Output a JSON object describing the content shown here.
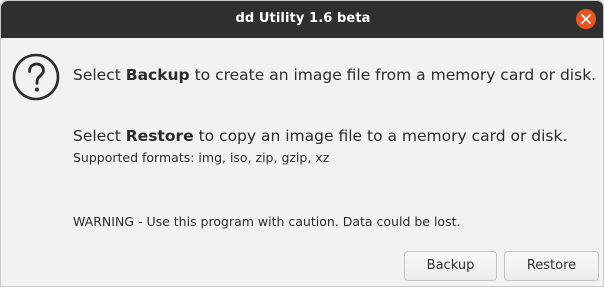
{
  "window": {
    "title": "dd Utility 1.6 beta",
    "accent_close_color": "#e95420",
    "titlebar_color": "#2f2f2f"
  },
  "icons": {
    "dialog": "question-mark-circle-icon",
    "close": "close-icon"
  },
  "message": {
    "line1_prefix": "Select ",
    "line1_bold": "Backup",
    "line1_suffix": " to create an image file from a memory card or disk.",
    "line2_prefix": "Select ",
    "line2_bold": "Restore",
    "line2_suffix": " to copy an image file to a memory card or disk.",
    "formats": "Supported formats: img, iso, zip, gzip, xz",
    "warning": "WARNING - Use this program with caution. Data could be lost."
  },
  "buttons": {
    "backup": "Backup",
    "restore": "Restore"
  }
}
